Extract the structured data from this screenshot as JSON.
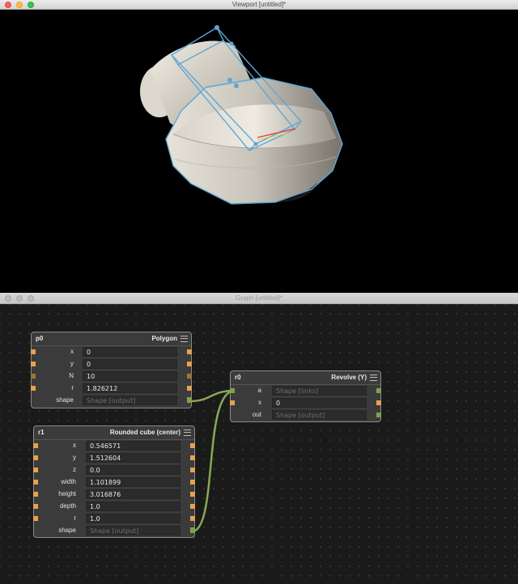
{
  "viewport_window": {
    "title": "Viewport [untitled]*"
  },
  "graph_window": {
    "title": "Graph [untitled]*"
  },
  "nodes": {
    "p0": {
      "id": "p0",
      "type": "Polygon",
      "fields": [
        {
          "label": "x",
          "value": "0"
        },
        {
          "label": "y",
          "value": "0"
        },
        {
          "label": "N",
          "value": "10"
        },
        {
          "label": "r",
          "value": "1.826212"
        }
      ],
      "output": {
        "label": "shape",
        "value": "Shape [output]"
      }
    },
    "r1": {
      "id": "r1",
      "type": "Rounded cube (center)",
      "fields": [
        {
          "label": "x",
          "value": "0.546571"
        },
        {
          "label": "y",
          "value": "1.512604"
        },
        {
          "label": "z",
          "value": "0.0"
        },
        {
          "label": "width",
          "value": "1.101899"
        },
        {
          "label": "height",
          "value": "3.016876"
        },
        {
          "label": "depth",
          "value": "1.0"
        },
        {
          "label": "r",
          "value": "1.0"
        }
      ],
      "output": {
        "label": "shape",
        "value": "Shape [output]"
      }
    },
    "r0": {
      "id": "r0",
      "type": "Revolve (Y)",
      "fields": [
        {
          "label": "a",
          "value": "Shape [links]"
        },
        {
          "label": "x",
          "value": "0"
        },
        {
          "label": "out",
          "value": "Shape [output]"
        }
      ]
    }
  },
  "colors": {
    "port_orange": "#e7a24c",
    "port_green": "#7ba34c",
    "wire": "#8aa855",
    "selection_outline": "#5fa6d6"
  }
}
